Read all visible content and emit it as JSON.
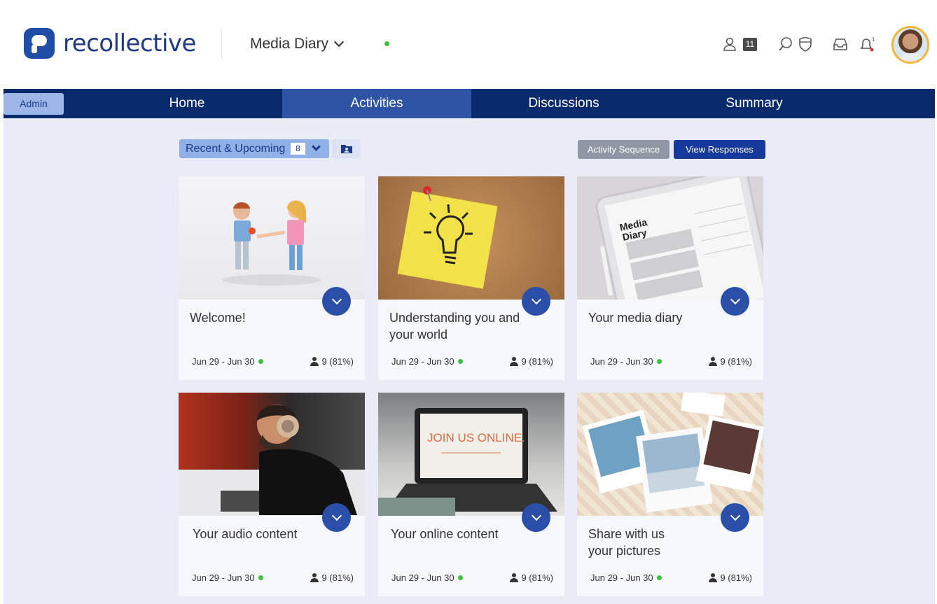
{
  "header": {
    "brand": "recollective",
    "project": "Media Diary",
    "member_count": "11"
  },
  "nav": {
    "admin": "Admin",
    "tabs": [
      "Home",
      "Activities",
      "Discussions",
      "Summary"
    ],
    "active": "Activities"
  },
  "toolbar": {
    "filter_label": "Recent & Upcoming",
    "filter_count": "8",
    "sequence_label": "Activity Sequence",
    "responses_label": "View Responses"
  },
  "cards": [
    {
      "title": "Welcome!",
      "dates": "Jun 29 - Jun 30",
      "responses": "9 (81%)",
      "image": "toy-figures-handshake"
    },
    {
      "title": "Understanding you and your world",
      "dates": "Jun 29 - Jun 30",
      "responses": "9 (81%)",
      "image": "lightbulb-sticky-note"
    },
    {
      "title": "Your media diary",
      "dates": "Jun 29 - Jun 30",
      "responses": "9 (81%)",
      "image": "tablet-media-diary"
    },
    {
      "title": "Your audio content",
      "dates": "Jun 29 - Jun 30",
      "responses": "9 (81%)",
      "image": "man-with-headphones"
    },
    {
      "title": "Your online content",
      "dates": "Jun 29 - Jun 30",
      "responses": "9 (81%)",
      "image": "laptop-join-us-online",
      "image_text": "JOIN US ONLINE."
    },
    {
      "title": "Share with us your pictures",
      "dates": "Jun 29 - Jun 30",
      "responses": "9 (81%)",
      "image": "polaroid-photos"
    }
  ],
  "colors": {
    "brand": "#1f4da8",
    "nav": "#0a2a6e",
    "nav_active": "#2f53a5",
    "status_dot": "#3cc13c",
    "primary_button": "#153a9b"
  }
}
